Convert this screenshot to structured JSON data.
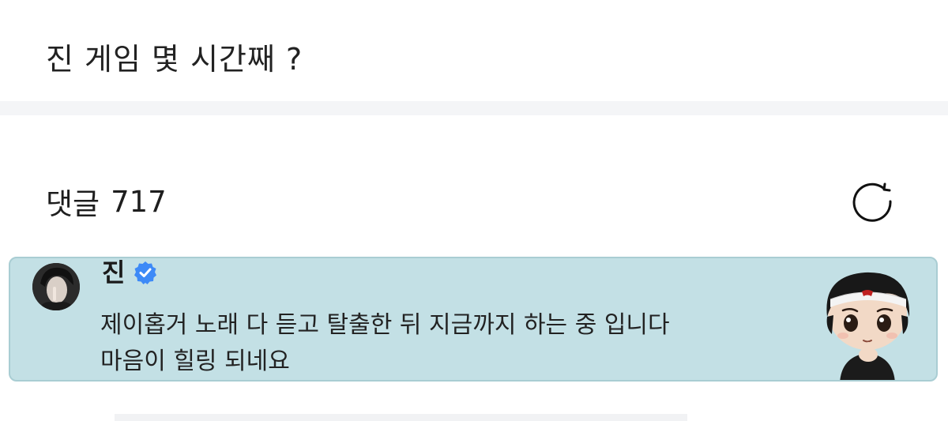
{
  "post": {
    "title": "진 게임 몇 시간째 ?"
  },
  "comments": {
    "label": "댓글",
    "count": "717",
    "refresh_icon": "refresh-icon"
  },
  "highlighted_comment": {
    "author": "진",
    "verified": true,
    "verified_icon": "verified-check-icon",
    "body_lines": [
      "제이홉거 노래 다 듣고 탈출한 뒤 지금까지 하는 중 입니다",
      "마음이 힐링 되네요"
    ],
    "sticker": "chibi-character-sticker",
    "colors": {
      "background": "#c3e0e5",
      "border": "#a9cdd3",
      "badge": "#3d8af7"
    }
  }
}
